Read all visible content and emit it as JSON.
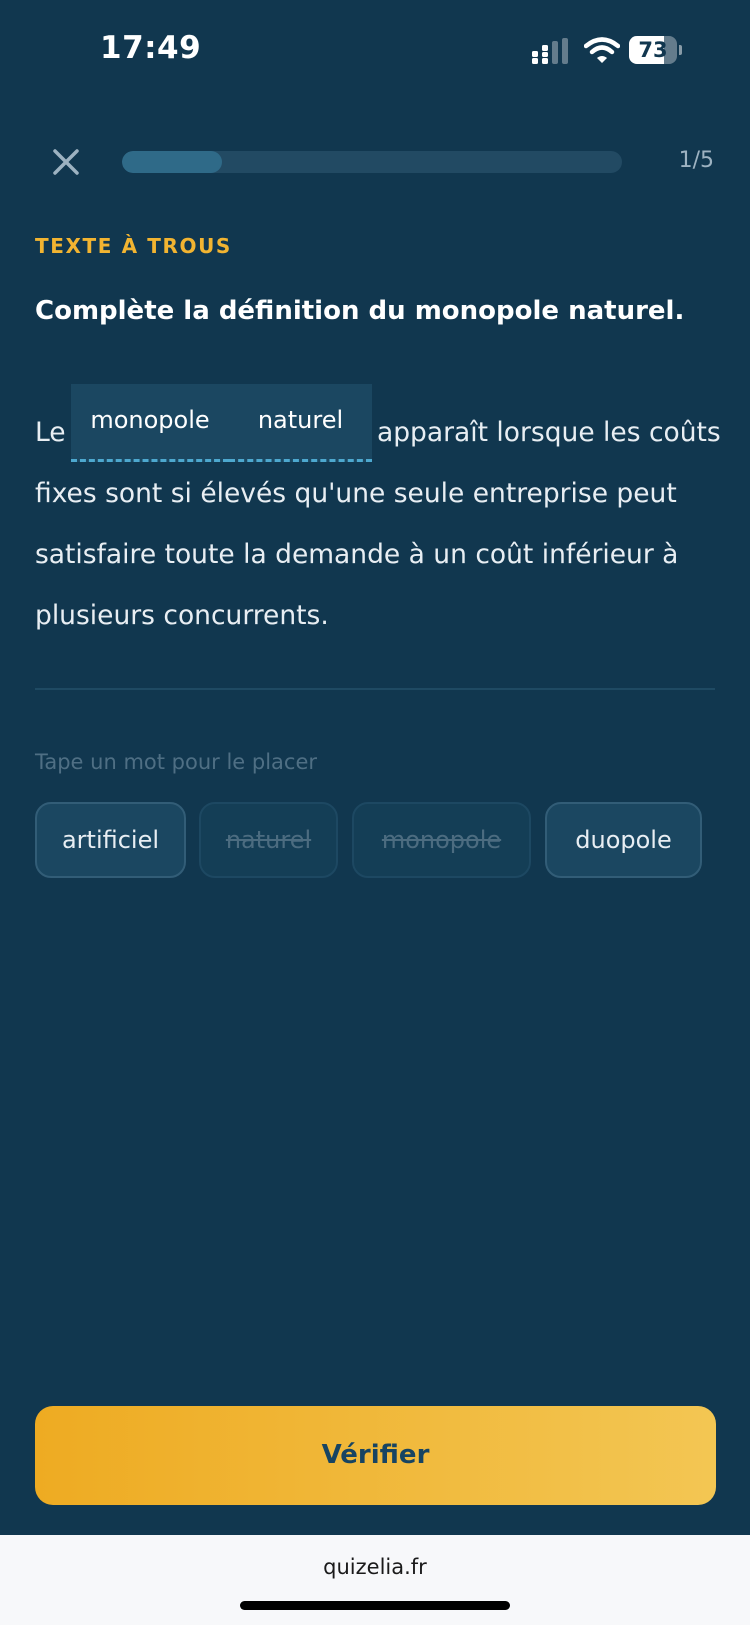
{
  "status_bar": {
    "time": "17:49",
    "battery": {
      "level": "73",
      "percent": 73
    },
    "icons": [
      "signal-icon",
      "wifi-icon",
      "battery-icon"
    ]
  },
  "quiz": {
    "close_icon": "close-icon",
    "progress": {
      "label": "1/5",
      "fraction": 0.2
    },
    "section_label": "TEXTE À TROUS",
    "question": "Complète la définition du monopole naturel.",
    "sentence": {
      "prefix": "Le",
      "blanks": [
        "monopole",
        "naturel"
      ],
      "line1_rest": "apparaît lorsque les coûts",
      "line2": "fixes sont si élevés qu'une seule entreprise peut",
      "line3": "satisfaire toute la demande à un coût inférieur à",
      "line4": "plusieurs concurrents."
    },
    "hint": "Tape un mot pour le placer",
    "choices": [
      {
        "label": "artificiel",
        "used": false
      },
      {
        "label": "naturel",
        "used": true
      },
      {
        "label": "monopole",
        "used": true
      },
      {
        "label": "duopole",
        "used": false
      }
    ],
    "verify_label": "Vérifier"
  },
  "browser": {
    "url": "quizelia.fr"
  },
  "colors": {
    "background": "#11374f",
    "accent": "#f2b431",
    "blank_underline": "#4da8cf"
  }
}
